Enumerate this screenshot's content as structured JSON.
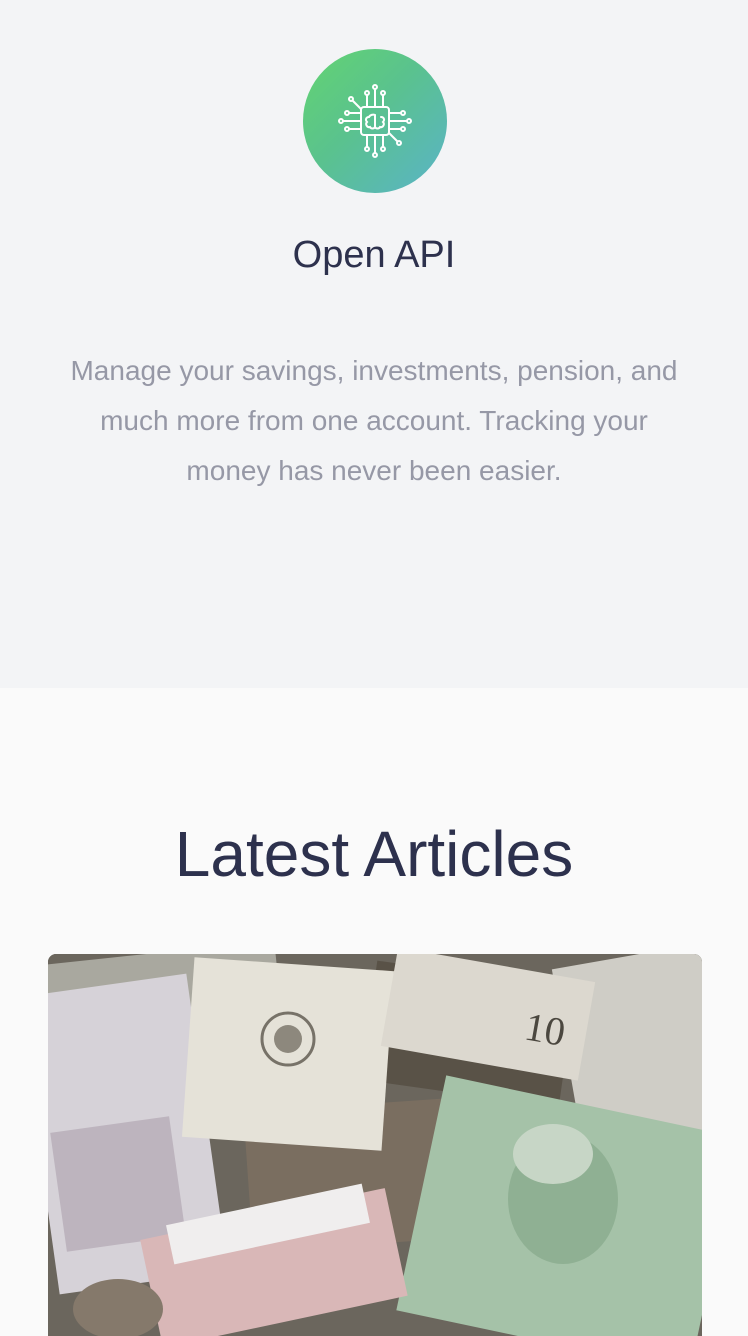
{
  "feature": {
    "icon": "ai-chip-brain-icon",
    "title": "Open API",
    "description": "Manage your savings, investments, pension, and much more from one account. Tracking your money has never been easier."
  },
  "articles": {
    "heading": "Latest Articles",
    "first_card_image": "currency-banknotes-photo"
  },
  "colors": {
    "gradient_start": "#63d471",
    "gradient_end": "#5ab3c8",
    "heading": "#2d314d",
    "body_text": "#9698a6"
  }
}
